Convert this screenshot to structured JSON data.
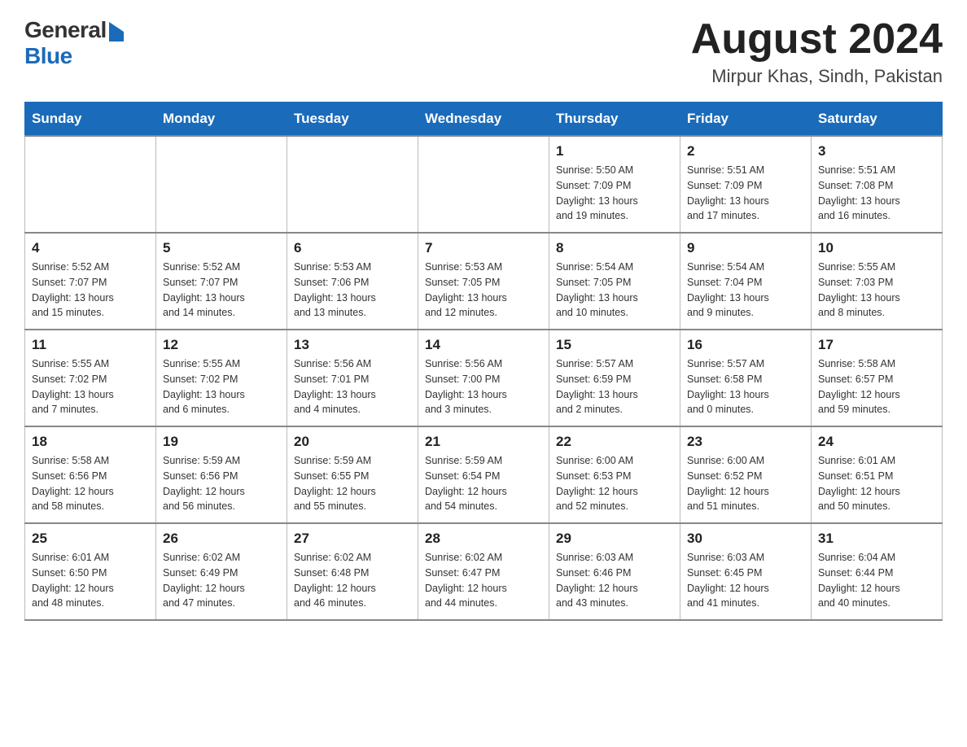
{
  "logo": {
    "general": "General",
    "blue": "Blue"
  },
  "header": {
    "month": "August 2024",
    "location": "Mirpur Khas, Sindh, Pakistan"
  },
  "days": [
    "Sunday",
    "Monday",
    "Tuesday",
    "Wednesday",
    "Thursday",
    "Friday",
    "Saturday"
  ],
  "weeks": [
    [
      {
        "day": "",
        "info": ""
      },
      {
        "day": "",
        "info": ""
      },
      {
        "day": "",
        "info": ""
      },
      {
        "day": "",
        "info": ""
      },
      {
        "day": "1",
        "info": "Sunrise: 5:50 AM\nSunset: 7:09 PM\nDaylight: 13 hours\nand 19 minutes."
      },
      {
        "day": "2",
        "info": "Sunrise: 5:51 AM\nSunset: 7:09 PM\nDaylight: 13 hours\nand 17 minutes."
      },
      {
        "day": "3",
        "info": "Sunrise: 5:51 AM\nSunset: 7:08 PM\nDaylight: 13 hours\nand 16 minutes."
      }
    ],
    [
      {
        "day": "4",
        "info": "Sunrise: 5:52 AM\nSunset: 7:07 PM\nDaylight: 13 hours\nand 15 minutes."
      },
      {
        "day": "5",
        "info": "Sunrise: 5:52 AM\nSunset: 7:07 PM\nDaylight: 13 hours\nand 14 minutes."
      },
      {
        "day": "6",
        "info": "Sunrise: 5:53 AM\nSunset: 7:06 PM\nDaylight: 13 hours\nand 13 minutes."
      },
      {
        "day": "7",
        "info": "Sunrise: 5:53 AM\nSunset: 7:05 PM\nDaylight: 13 hours\nand 12 minutes."
      },
      {
        "day": "8",
        "info": "Sunrise: 5:54 AM\nSunset: 7:05 PM\nDaylight: 13 hours\nand 10 minutes."
      },
      {
        "day": "9",
        "info": "Sunrise: 5:54 AM\nSunset: 7:04 PM\nDaylight: 13 hours\nand 9 minutes."
      },
      {
        "day": "10",
        "info": "Sunrise: 5:55 AM\nSunset: 7:03 PM\nDaylight: 13 hours\nand 8 minutes."
      }
    ],
    [
      {
        "day": "11",
        "info": "Sunrise: 5:55 AM\nSunset: 7:02 PM\nDaylight: 13 hours\nand 7 minutes."
      },
      {
        "day": "12",
        "info": "Sunrise: 5:55 AM\nSunset: 7:02 PM\nDaylight: 13 hours\nand 6 minutes."
      },
      {
        "day": "13",
        "info": "Sunrise: 5:56 AM\nSunset: 7:01 PM\nDaylight: 13 hours\nand 4 minutes."
      },
      {
        "day": "14",
        "info": "Sunrise: 5:56 AM\nSunset: 7:00 PM\nDaylight: 13 hours\nand 3 minutes."
      },
      {
        "day": "15",
        "info": "Sunrise: 5:57 AM\nSunset: 6:59 PM\nDaylight: 13 hours\nand 2 minutes."
      },
      {
        "day": "16",
        "info": "Sunrise: 5:57 AM\nSunset: 6:58 PM\nDaylight: 13 hours\nand 0 minutes."
      },
      {
        "day": "17",
        "info": "Sunrise: 5:58 AM\nSunset: 6:57 PM\nDaylight: 12 hours\nand 59 minutes."
      }
    ],
    [
      {
        "day": "18",
        "info": "Sunrise: 5:58 AM\nSunset: 6:56 PM\nDaylight: 12 hours\nand 58 minutes."
      },
      {
        "day": "19",
        "info": "Sunrise: 5:59 AM\nSunset: 6:56 PM\nDaylight: 12 hours\nand 56 minutes."
      },
      {
        "day": "20",
        "info": "Sunrise: 5:59 AM\nSunset: 6:55 PM\nDaylight: 12 hours\nand 55 minutes."
      },
      {
        "day": "21",
        "info": "Sunrise: 5:59 AM\nSunset: 6:54 PM\nDaylight: 12 hours\nand 54 minutes."
      },
      {
        "day": "22",
        "info": "Sunrise: 6:00 AM\nSunset: 6:53 PM\nDaylight: 12 hours\nand 52 minutes."
      },
      {
        "day": "23",
        "info": "Sunrise: 6:00 AM\nSunset: 6:52 PM\nDaylight: 12 hours\nand 51 minutes."
      },
      {
        "day": "24",
        "info": "Sunrise: 6:01 AM\nSunset: 6:51 PM\nDaylight: 12 hours\nand 50 minutes."
      }
    ],
    [
      {
        "day": "25",
        "info": "Sunrise: 6:01 AM\nSunset: 6:50 PM\nDaylight: 12 hours\nand 48 minutes."
      },
      {
        "day": "26",
        "info": "Sunrise: 6:02 AM\nSunset: 6:49 PM\nDaylight: 12 hours\nand 47 minutes."
      },
      {
        "day": "27",
        "info": "Sunrise: 6:02 AM\nSunset: 6:48 PM\nDaylight: 12 hours\nand 46 minutes."
      },
      {
        "day": "28",
        "info": "Sunrise: 6:02 AM\nSunset: 6:47 PM\nDaylight: 12 hours\nand 44 minutes."
      },
      {
        "day": "29",
        "info": "Sunrise: 6:03 AM\nSunset: 6:46 PM\nDaylight: 12 hours\nand 43 minutes."
      },
      {
        "day": "30",
        "info": "Sunrise: 6:03 AM\nSunset: 6:45 PM\nDaylight: 12 hours\nand 41 minutes."
      },
      {
        "day": "31",
        "info": "Sunrise: 6:04 AM\nSunset: 6:44 PM\nDaylight: 12 hours\nand 40 minutes."
      }
    ]
  ]
}
